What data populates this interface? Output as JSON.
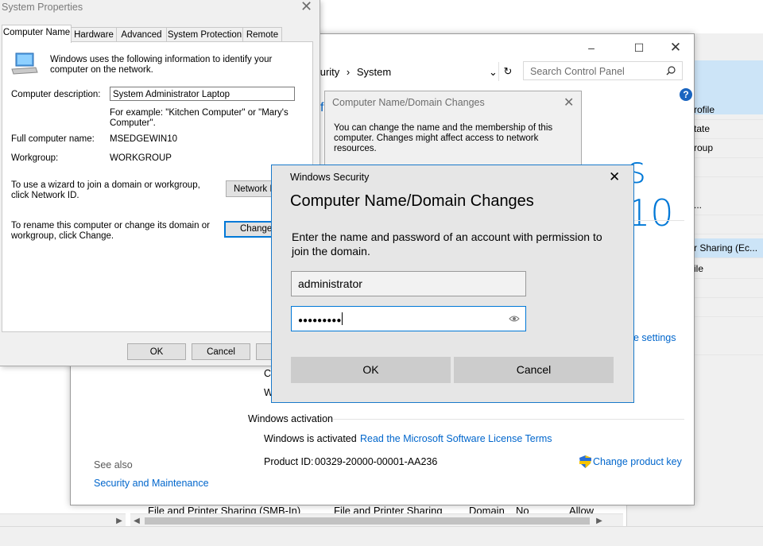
{
  "background": {
    "right_panel_items": [
      "rofile",
      "tate",
      "roup",
      "...",
      "r Sharing (Ec...",
      "ile"
    ],
    "list_row": [
      "File and Printer Sharing (SMB-In)",
      "File and Printer Sharing",
      "Domain",
      "No",
      "Allow"
    ]
  },
  "control_panel": {
    "breadcrumb": [
      "ecurity",
      "System"
    ],
    "search_placeholder": "Search Control Panel",
    "windows_logo_text": "s 10",
    "partial_letters": [
      "f",
      "C",
      "W"
    ],
    "change_settings_link": "e settings",
    "activation_header": "Windows activation",
    "activation_status": "Windows is activated",
    "license_link": "Read the Microsoft Software License Terms",
    "product_id_label": "Product ID:",
    "product_id": "00329-20000-00001-AA236",
    "change_product_key": "Change product key",
    "see_also": "See also",
    "security_link": "Security and Maintenance"
  },
  "system_properties": {
    "title": "System Properties",
    "tabs": [
      "Computer Name",
      "Hardware",
      "Advanced",
      "System Protection",
      "Remote"
    ],
    "intro": "Windows uses the following information to identify your computer on the network.",
    "desc_label": "Computer description:",
    "desc_value": "System Administrator Laptop",
    "example": "For example: \"Kitchen Computer\" or \"Mary's Computer\".",
    "full_name_label": "Full computer name:",
    "full_name_value": "MSEDGEWIN10",
    "workgroup_label": "Workgroup:",
    "workgroup_value": "WORKGROUP",
    "wizard_text": "To use a wizard to join a domain or workgroup, click Network ID.",
    "network_id_btn": "Network I",
    "rename_text": "To rename this computer or change its domain or workgroup, click Change.",
    "change_btn": "Change",
    "ok": "OK",
    "cancel": "Cancel"
  },
  "cndc_behind": {
    "title": "Computer Name/Domain Changes",
    "body": "You can change the name and the membership of this computer. Changes might affect access to network resources."
  },
  "windows_security": {
    "caption": "Windows Security",
    "heading": "Computer Name/Domain Changes",
    "message": "Enter the name and password of an account with permission to join the domain.",
    "username": "administrator",
    "password_mask": "●●●●●●●●●",
    "ok": "OK",
    "cancel": "Cancel"
  }
}
